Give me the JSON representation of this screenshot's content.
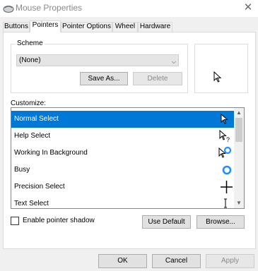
{
  "window": {
    "title": "Mouse Properties",
    "close_glyph": "✕"
  },
  "tabs": [
    {
      "label": "Buttons",
      "active": false
    },
    {
      "label": "Pointers",
      "active": true
    },
    {
      "label": "Pointer Options",
      "active": false
    },
    {
      "label": "Wheel",
      "active": false
    },
    {
      "label": "Hardware",
      "active": false
    }
  ],
  "scheme": {
    "label": "Scheme",
    "selected": "(None)",
    "save_as_label": "Save As...",
    "delete_label": "Delete"
  },
  "customize": {
    "label": "Customize:",
    "items": [
      {
        "label": "Normal Select",
        "icon": "arrow-cursor-icon",
        "selected": true
      },
      {
        "label": "Help Select",
        "icon": "help-cursor-icon",
        "selected": false
      },
      {
        "label": "Working In Background",
        "icon": "working-cursor-icon",
        "selected": false
      },
      {
        "label": "Busy",
        "icon": "busy-cursor-icon",
        "selected": false
      },
      {
        "label": "Precision Select",
        "icon": "crosshair-cursor-icon",
        "selected": false
      },
      {
        "label": "Text Select",
        "icon": "ibeam-cursor-icon",
        "selected": false
      }
    ]
  },
  "options": {
    "enable_shadow_label": "Enable pointer shadow",
    "enable_shadow_checked": false,
    "use_default_label": "Use Default",
    "browse_label": "Browse..."
  },
  "footer": {
    "ok_label": "OK",
    "cancel_label": "Cancel",
    "apply_label": "Apply"
  },
  "colors": {
    "selection": "#0078d7",
    "busy_ring": "#1e90ff"
  }
}
